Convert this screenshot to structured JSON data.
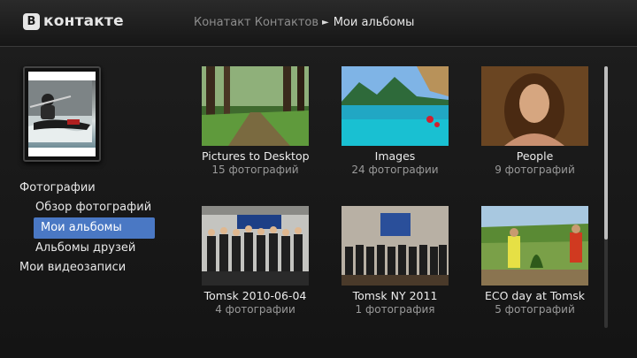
{
  "app": {
    "logo_letter": "B",
    "logo_text": "контакте"
  },
  "breadcrumb": {
    "parent": "Конатакт Контактов",
    "separator": "►",
    "current": "Мои альбомы"
  },
  "menu": {
    "photos": "Фотографии",
    "photo_overview": "Обзор фотографий",
    "my_albums": "Мои альбомы",
    "friends_albums": "Альбомы друзей",
    "my_videos": "Мои видеозаписи"
  },
  "albums": [
    {
      "title": "Pictures to Desktop",
      "count": "15 фотографий",
      "thumb": "forest-road"
    },
    {
      "title": "Images",
      "count": "24 фотографии",
      "thumb": "tropical-beach"
    },
    {
      "title": "People",
      "count": "9 фотографий",
      "thumb": "portrait"
    },
    {
      "title": "Tomsk 2010-06-04",
      "count": "4 фотографии",
      "thumb": "group-photo"
    },
    {
      "title": "Tomsk NY 2011",
      "count": "1 фотография",
      "thumb": "group-photo-banner"
    },
    {
      "title": "ECO day at  Tomsk",
      "count": "5 фотографий",
      "thumb": "tree-planting"
    }
  ],
  "colors": {
    "accent": "#4a78c4",
    "background": "#1b1b1b",
    "muted_text": "#9a9a9a"
  }
}
